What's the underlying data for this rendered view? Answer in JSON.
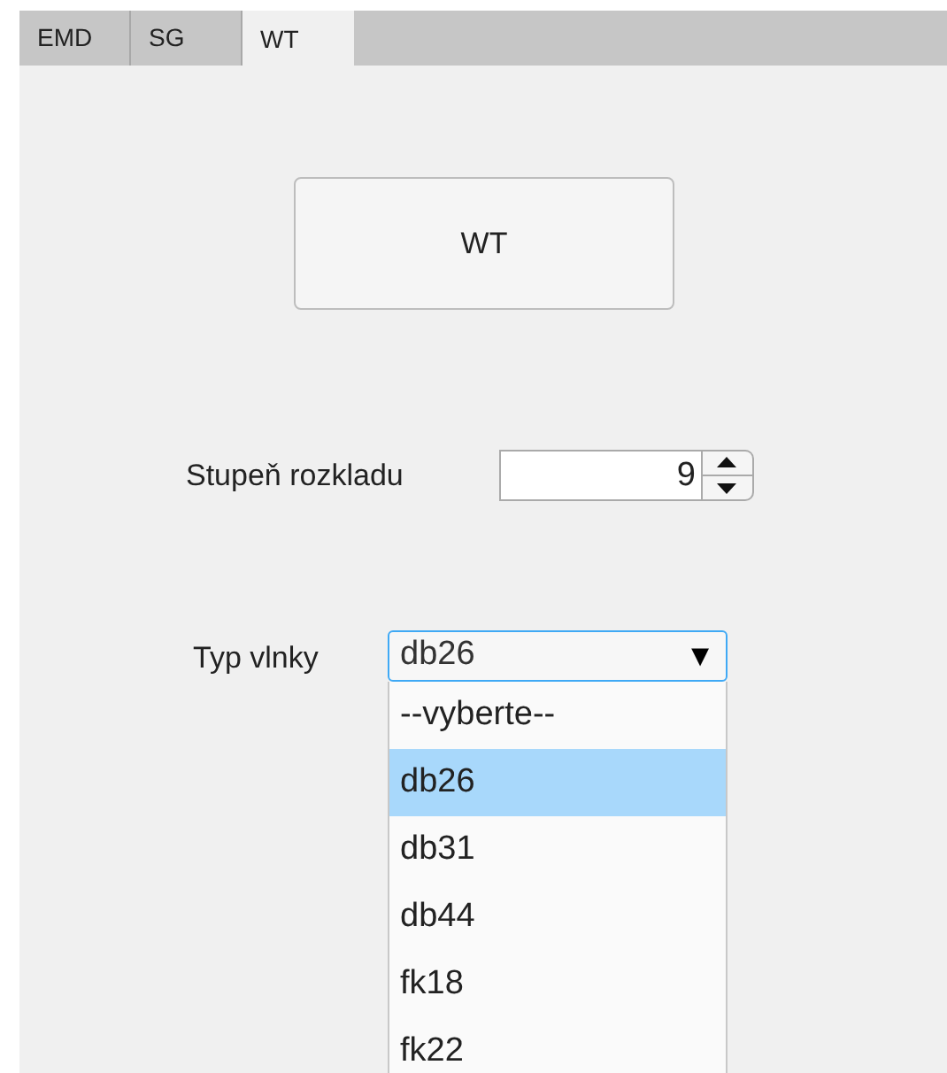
{
  "tabs": [
    {
      "label": "EMD",
      "selected": false
    },
    {
      "label": "SG",
      "selected": false
    },
    {
      "label": "WT",
      "selected": true
    }
  ],
  "button": {
    "label": "WT"
  },
  "spinner": {
    "label": "Stupeň rozkladu",
    "value": "9"
  },
  "dropdown": {
    "label": "Typ vlnky",
    "value": "db26",
    "arrow": "▼",
    "expanded": true,
    "options": [
      {
        "label": "--vyberte--",
        "selected": false
      },
      {
        "label": "db26",
        "selected": true
      },
      {
        "label": "db31",
        "selected": false
      },
      {
        "label": "db44",
        "selected": false
      },
      {
        "label": "fk18",
        "selected": false
      },
      {
        "label": "fk22",
        "selected": false
      }
    ]
  }
}
